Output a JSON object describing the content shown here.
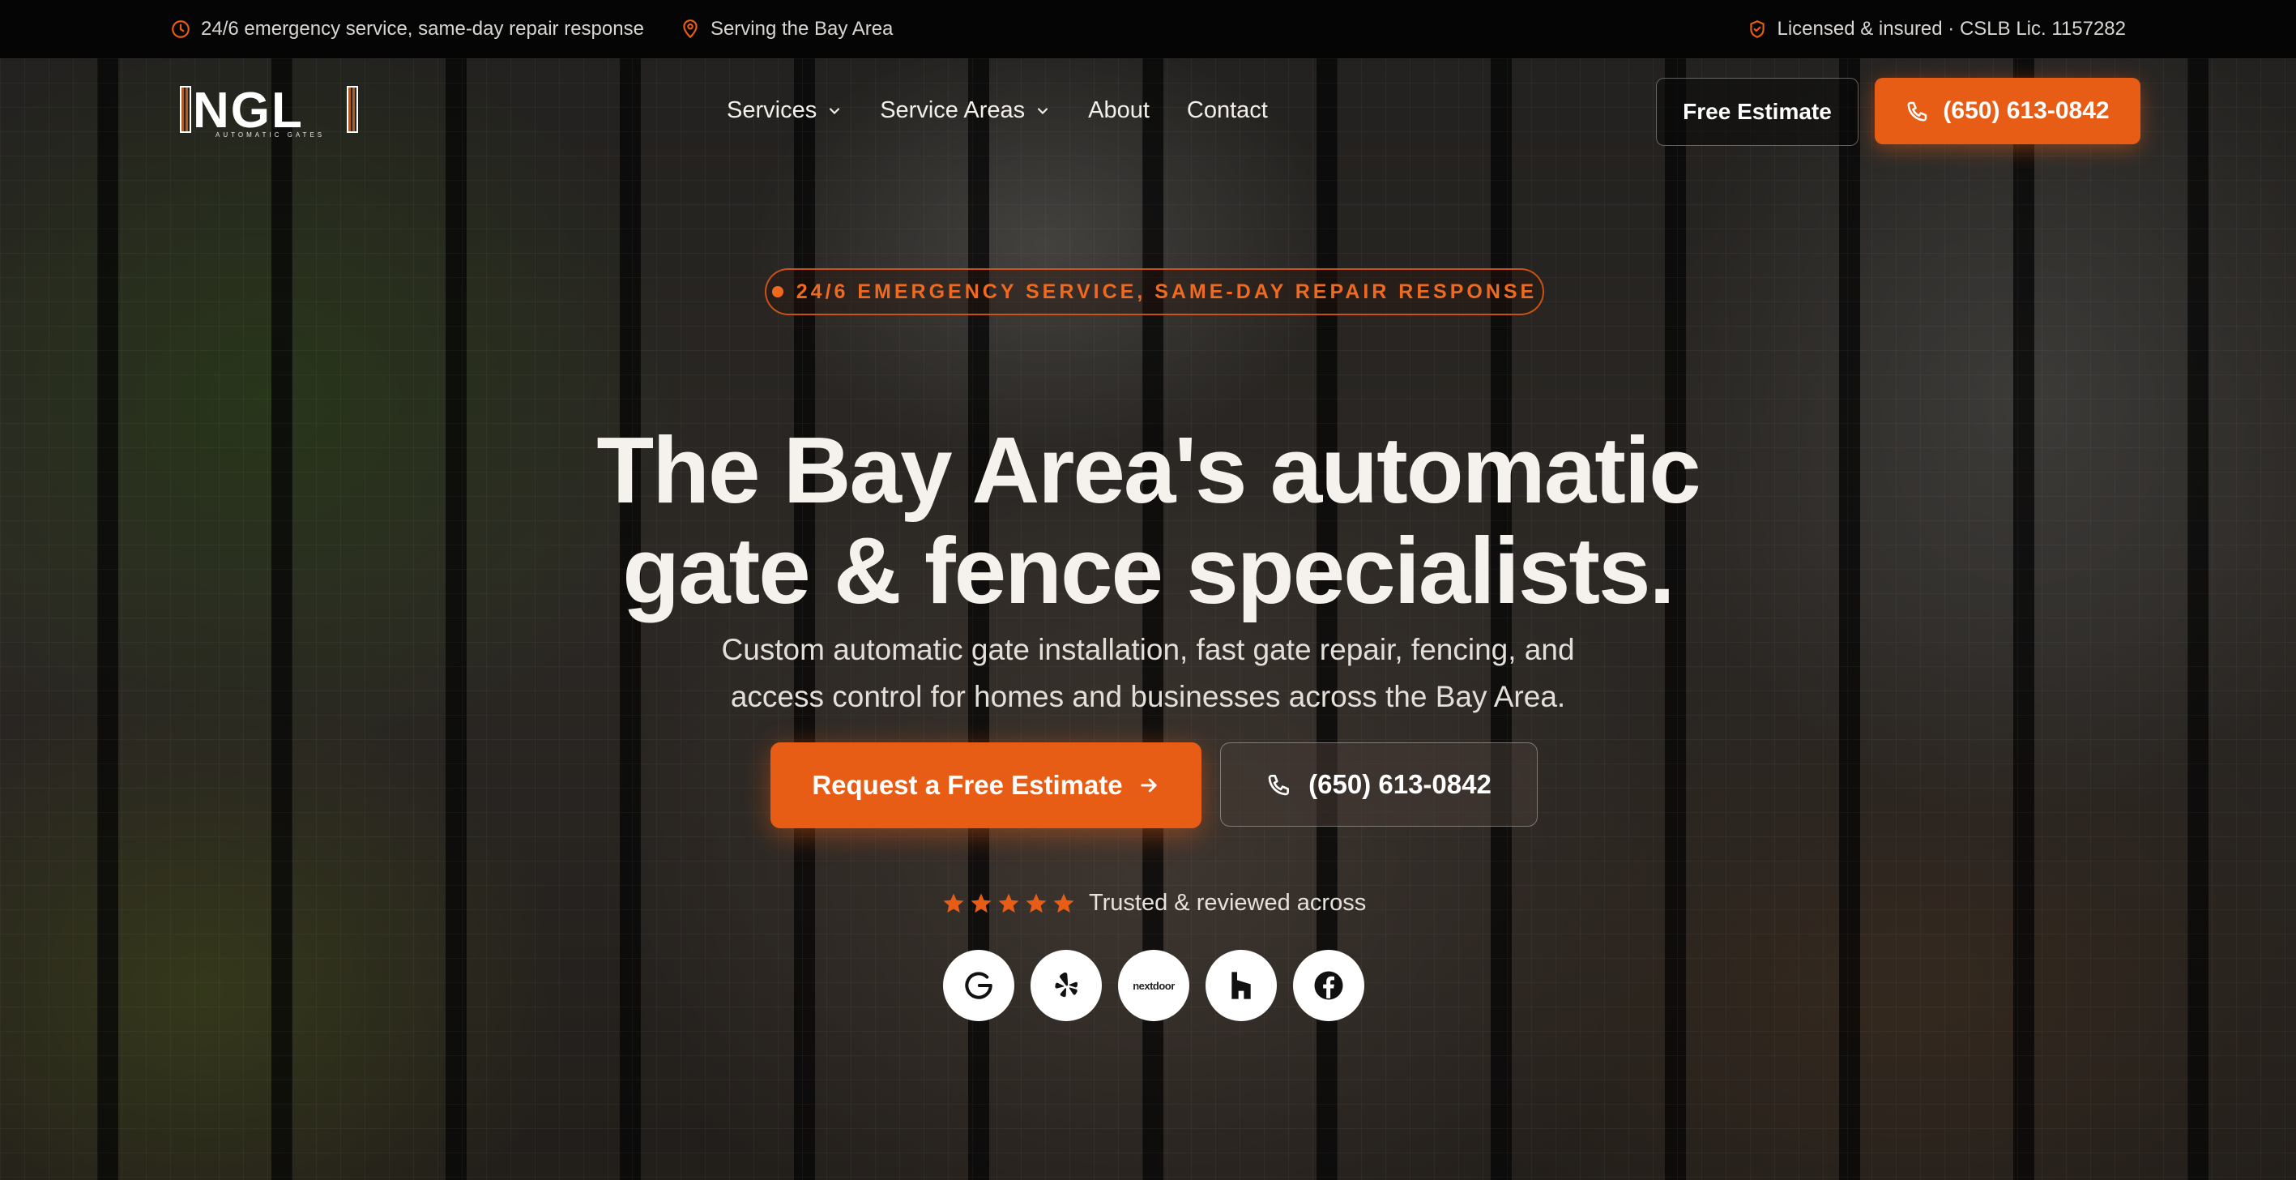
{
  "topbar": {
    "emergency_text": "24/6 emergency service, same-day repair response",
    "area_text": "Serving the Bay Area",
    "license_text": "Licensed & insured · CSLB Lic. 1157282"
  },
  "nav": {
    "logo_wordmark": "NGL",
    "logo_subtext": "AUTOMATIC GATES",
    "menu": {
      "services": "Services",
      "service_areas": "Service Areas",
      "about": "About",
      "contact": "Contact"
    },
    "free_estimate_label": "Free Estimate",
    "phone_label": "(650) 613-0842"
  },
  "hero": {
    "badge_text": "24/6 EMERGENCY SERVICE, SAME-DAY REPAIR RESPONSE",
    "headline_line1": "The Bay Area's automatic",
    "headline_line2": "gate & fence specialists.",
    "subtext_line1": "Custom automatic gate installation, fast gate repair, fencing, and",
    "subtext_line2": "access control for homes and businesses across the Bay Area.",
    "cta_primary": "Request a Free Estimate",
    "cta_secondary": "(650) 613-0842",
    "trust_text": "Trusted & reviewed across",
    "rating_stars": 5,
    "review_sites": [
      "google-icon",
      "yelp-icon",
      "nextdoor-icon",
      "houzz-icon",
      "facebook-icon"
    ],
    "nextdoor_label": "nextdoor"
  },
  "colors": {
    "accent": "#e85d15",
    "topbar_bg": "#050505",
    "text": "#f5f1ec"
  }
}
